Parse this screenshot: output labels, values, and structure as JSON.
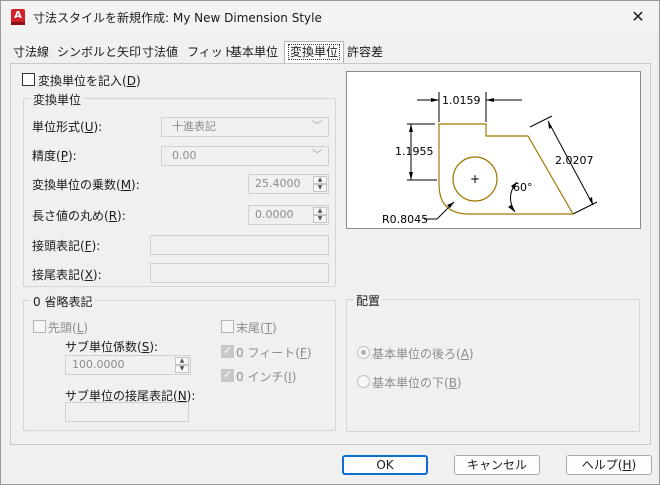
{
  "window": {
    "title": "寸法スタイルを新規作成: My New Dimension Style",
    "app_icon": "A",
    "close_icon": "✕"
  },
  "tabs": [
    {
      "label": "寸法線"
    },
    {
      "label": "シンボルと矢印"
    },
    {
      "label": "寸法値"
    },
    {
      "label": "フィット"
    },
    {
      "label": "基本単位"
    },
    {
      "label": "変換単位",
      "active": true
    },
    {
      "label": "許容差"
    }
  ],
  "alt_units": {
    "enable_label_pre": "変換単位を記入(",
    "enable_label_key": "D",
    "enable_label_post": ")",
    "enable_checked": false,
    "group_title": "変換単位",
    "unit_format_label_pre": "単位形式(",
    "unit_format_key": "U",
    "unit_format_value": "十進表記",
    "precision_label_pre": "精度(",
    "precision_key": "P",
    "precision_value": "0.00",
    "multiplier_label_pre": "変換単位の乗数(",
    "multiplier_key": "M",
    "multiplier_value": "25.4000",
    "round_label_pre": "長さ値の丸め(",
    "round_key": "R",
    "round_value": "0.0000",
    "prefix_label_pre": "接頭表記(",
    "prefix_key": "F",
    "suffix_label_pre": "接尾表記(",
    "suffix_key": "X",
    "close_paren": "):"
  },
  "zero_suppression": {
    "group_title": "0 省略表記",
    "leading_label_pre": "先頭(",
    "leading_key": "L",
    "trailing_label_pre": "末尾(",
    "trailing_key": "T",
    "sub_factor_label_pre": "サブ単位係数(",
    "sub_factor_key": "S",
    "sub_factor_value": "100.0000",
    "sub_suffix_label_pre": "サブ単位の接尾表記(",
    "sub_suffix_key": "N",
    "feet_label_pre": "0 フィート(",
    "feet_key": "F",
    "inch_label_pre": "0 インチ(",
    "inch_key": "I",
    "close_paren": ")",
    "close_paren_colon": "):"
  },
  "placement": {
    "group_title": "配置",
    "after_label_pre": "基本単位の後ろ(",
    "after_key": "A",
    "below_label_pre": "基本単位の下(",
    "below_key": "B",
    "close_paren": ")",
    "selected": "after"
  },
  "preview": {
    "dim_top": "1.0159",
    "dim_left": "1.1955",
    "dim_right": "2.0207",
    "angle": "60°",
    "radius": "R0.8045",
    "center_mark": "+"
  },
  "buttons": {
    "ok": "OK",
    "cancel": "キャンセル",
    "help_pre": "ヘルプ(",
    "help_key": "H",
    "help_post": ")"
  },
  "colors": {
    "accent": "#0b6fd2",
    "preview_shape": "#a07800",
    "app_icon": "#d1202a"
  }
}
